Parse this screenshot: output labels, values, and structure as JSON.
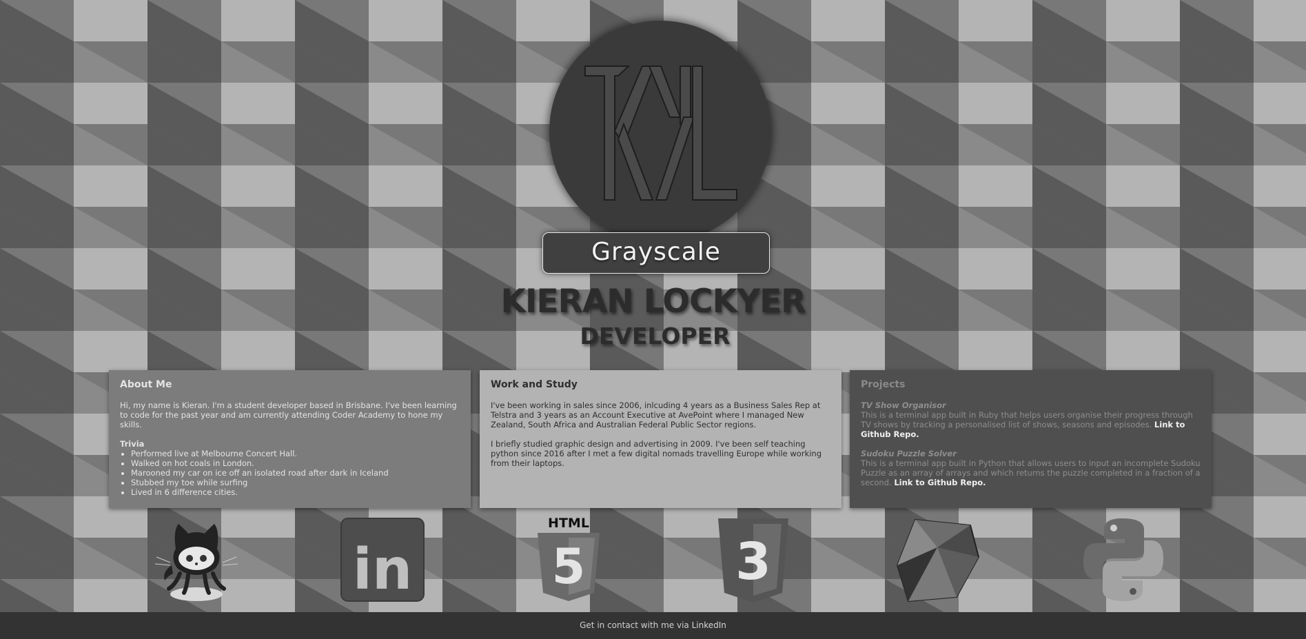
{
  "theme": {
    "button_label": "Grayscale"
  },
  "logo": {
    "initials": "KL"
  },
  "hero": {
    "name": "KIERAN LOCKYER",
    "role": "DEVELOPER"
  },
  "about": {
    "title": "About Me",
    "intro": "Hi, my name is Kieran. I'm a student developer based in Brisbane. I've been learning to code for the past year and am currently attending Coder Academy to hone my skills.",
    "trivia_title": "Trivia",
    "trivia": [
      "Performed live at Melbourne Concert Hall.",
      "Walked on hot coals in London.",
      "Marooned my car on ice off an isolated road after dark in Iceland",
      "Stubbed my toe while surfing",
      "Lived in 6 difference cities."
    ]
  },
  "work": {
    "title": "Work and Study",
    "para1": "I've been working in sales since 2006, inlcuding 4 years as a Business Sales Rep at Telstra and 3 years as an Account Executive at AvePoint where I managed New Zealand, South Africa and Australian Federal Public Sector regions.",
    "para2": "I briefly studied graphic design and advertising in 2009. I've been self teaching python since 2016 after I met a few digital nomads travelling Europe while working from their laptops."
  },
  "projects": {
    "title": "Projects",
    "items": [
      {
        "name": "TV Show Organisor",
        "desc": "This is a terminal app built in Ruby that helps users organise their progress through TV shows by tracking a personalised list of shows, seasons and episodes.",
        "link": "Link to Github Repo."
      },
      {
        "name": "Sudoku Puzzle Solver",
        "desc": "This is a terminal app built in Python that allows users to input an incomplete Sudoku Puzzle as an array of arrays and which returns the puzzle completed in a fraction of a second.",
        "link": "Link to Github Repo."
      }
    ]
  },
  "icons": [
    "github-octocat-icon",
    "linkedin-icon",
    "html5-icon",
    "css3-icon",
    "ruby-icon",
    "python-icon"
  ],
  "icon_text": {
    "html5": "HTML",
    "html5_num": "5",
    "css3_num": "3",
    "linkedin": "in"
  },
  "footer": {
    "text": "Get in contact with me via",
    "link": "LinkedIn"
  }
}
